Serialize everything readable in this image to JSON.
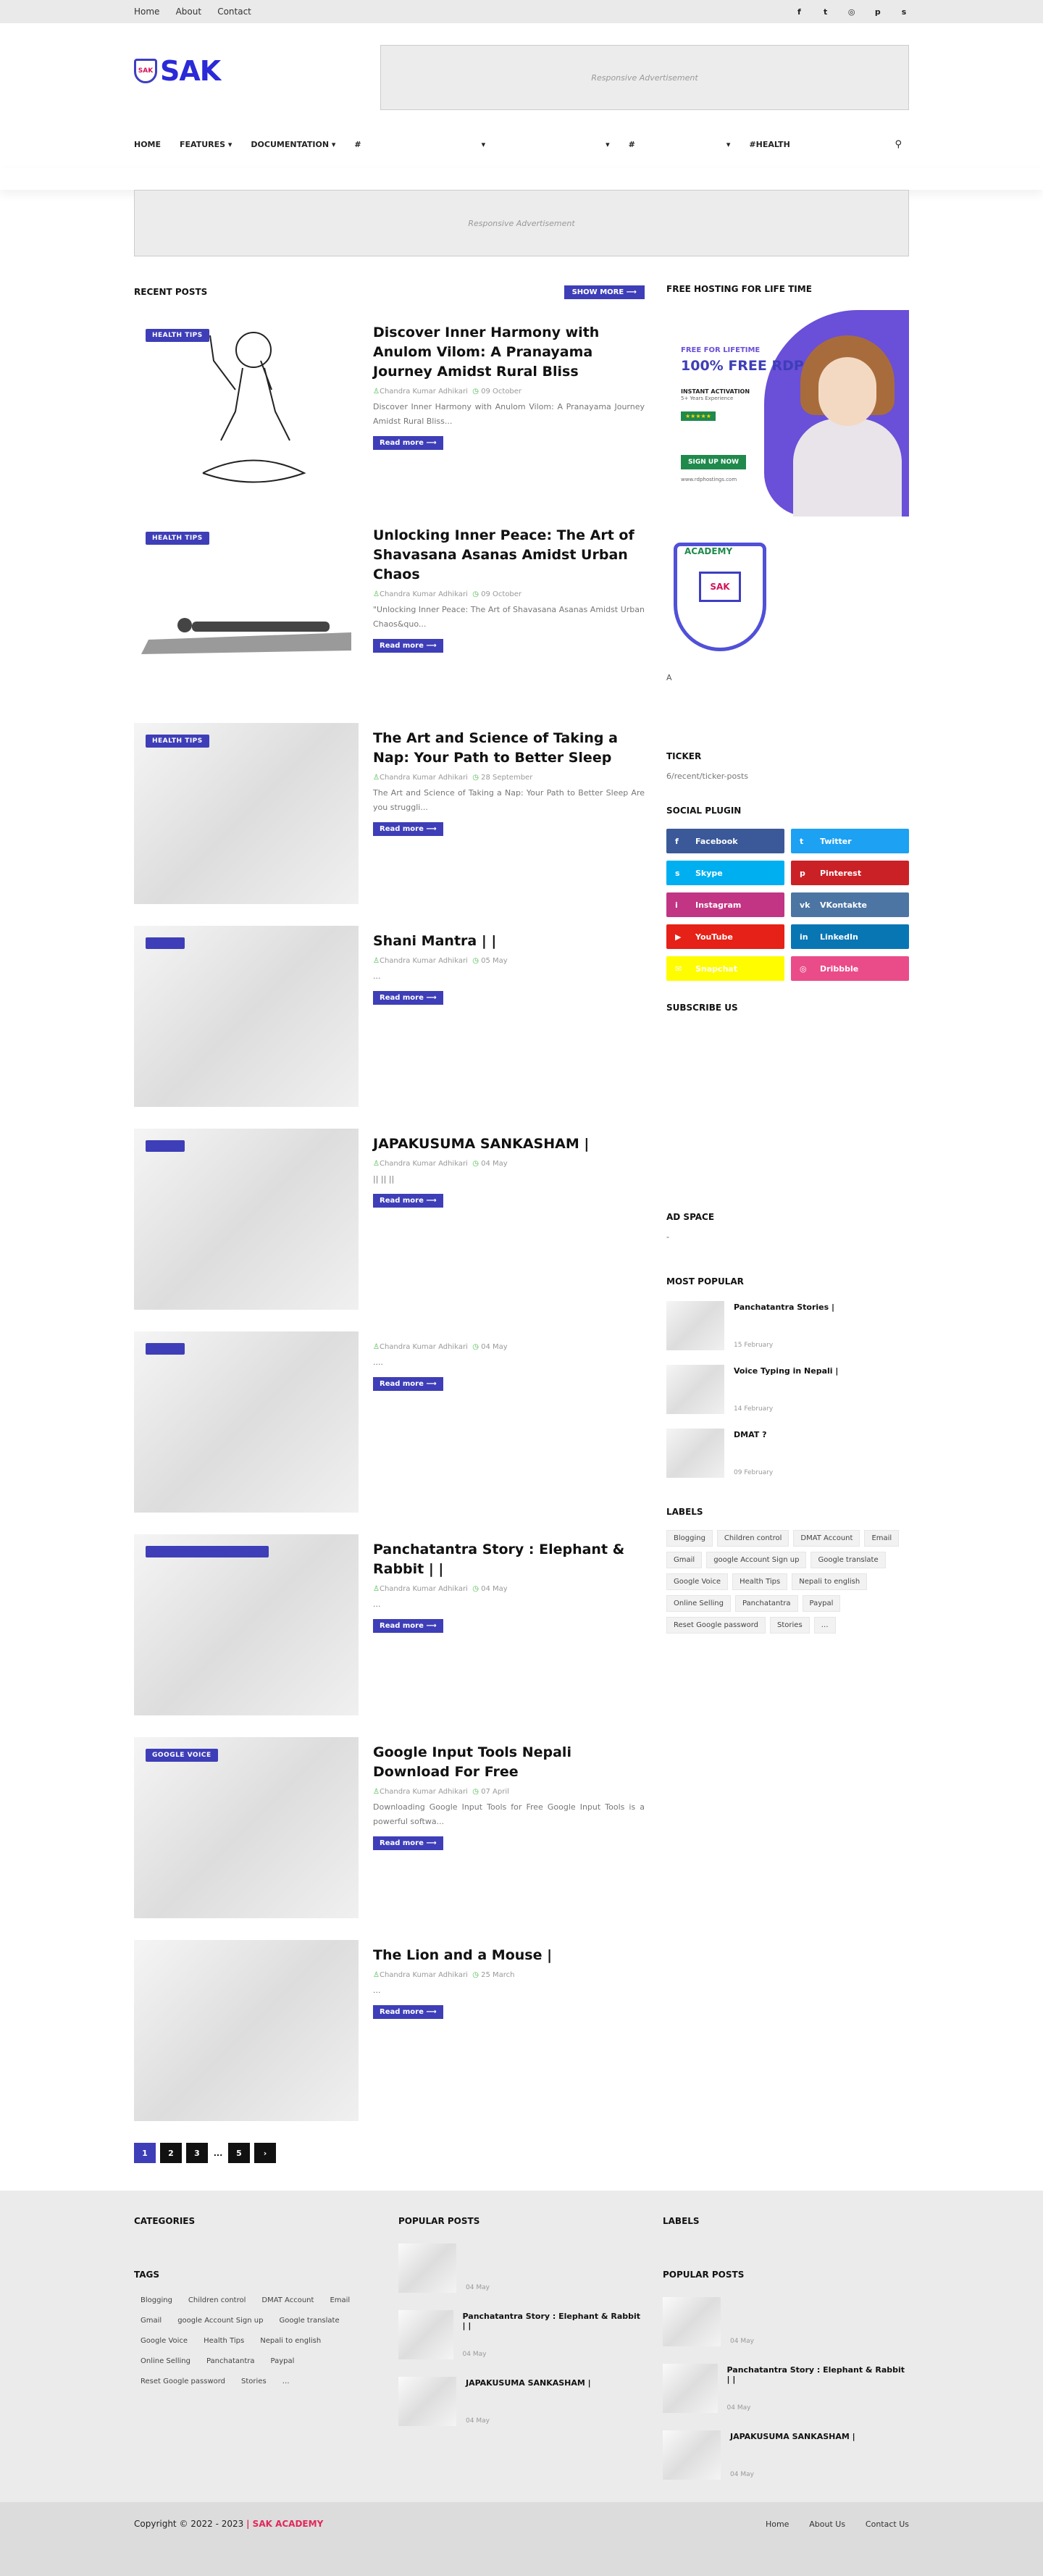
{
  "topbar": {
    "menu": [
      "Home",
      "About",
      "Contact"
    ],
    "social_icons": [
      "facebook-icon",
      "twitter-icon",
      "instagram-icon",
      "pinterest-icon",
      "skype-icon"
    ]
  },
  "header": {
    "logo_text": "SAK",
    "logo_badge": "SAK",
    "ad_text": "Responsive Advertisement"
  },
  "nav": {
    "items": [
      "HOME",
      "FEATURES ▾",
      "DOCUMENTATION ▾",
      "#",
      "▾",
      "▾",
      "#",
      "▾",
      "#HEALTH"
    ]
  },
  "ad2_text": "Responsive Advertisement",
  "main": {
    "heading": "RECENT POSTS",
    "show_more": "SHOW MORE ⟶",
    "read_more": "Read more ⟶",
    "posts": [
      {
        "badge": "HEALTH TIPS",
        "title": "Discover Inner Harmony with Anulom Vilom: A Pranayama Journey Amidst Rural Bliss",
        "author": "Chandra Kumar Adhikari",
        "date": "09 October",
        "snippet": "Discover Inner Harmony with Anulom Vilom: A Pranayama Journey Amidst Rural Bliss..."
      },
      {
        "badge": "HEALTH TIPS",
        "title": "Unlocking Inner Peace: The Art of Shavasana Asanas Amidst Urban Chaos",
        "author": "Chandra Kumar Adhikari",
        "date": "09 October",
        "snippet": "\"Unlocking Inner Peace: The Art of Shavasana Asanas Amidst Urban Chaos&quo..."
      },
      {
        "badge": "HEALTH TIPS",
        "title": "The Art and Science of Taking a Nap: Your Path to Better Sleep",
        "author": "Chandra Kumar Adhikari",
        "date": "28 September",
        "snippet": "The Art and Science of Taking a Nap: Your Path to Better Sleep Are you struggli..."
      },
      {
        "badge": "",
        "title": "Shani Mantra |                               |",
        "author": "Chandra Kumar Adhikari",
        "date": "05 May",
        "snippet": "..."
      },
      {
        "badge": "",
        "title": "JAPAKUSUMA SANKASHAM |",
        "author": "Chandra Kumar Adhikari",
        "date": "04 May",
        "snippet": "||    ||                                               ||"
      },
      {
        "badge": "",
        "title": "",
        "author": "Chandra Kumar Adhikari",
        "date": "04 May",
        "snippet": "...."
      },
      {
        "badge": "",
        "title": "Panchatantra Story : Elephant & Rabbit |                              |",
        "author": "Chandra Kumar Adhikari",
        "date": "04 May",
        "snippet": "..."
      },
      {
        "badge": "GOOGLE VOICE",
        "title": "Google Input Tools Nepali Download For Free",
        "author": "Chandra Kumar Adhikari",
        "date": "07 April",
        "snippet": "Downloading Google Input Tools for Free Google Input Tools is a powerful softwa..."
      },
      {
        "badge": "",
        "title": "The Lion and a Mouse |",
        "author": "Chandra Kumar Adhikari",
        "date": "25 March",
        "snippet": "..."
      }
    ],
    "pager": [
      "1",
      "2",
      "3",
      "...",
      "5",
      "›"
    ]
  },
  "sidebar": {
    "hosting_title": "FREE HOSTING FOR LIFE TIME",
    "banner": {
      "t1": "FREE FOR LIFETIME",
      "t2": "100% FREE RDP",
      "t3": "INSTANT ACTIVATION",
      "t4": "5+ Years Experience",
      "stars": "★★★★★",
      "signup": "SIGN UP NOW",
      "url": "www.rdphostings.com"
    },
    "academy": {
      "tag": "ACADEMY",
      "mon": "SAK"
    },
    "letter": "A",
    "ticker_title": "TICKER",
    "ticker_text": "6/recent/ticker-posts",
    "social_title": "SOCIAL PLUGIN",
    "social": [
      {
        "label": "Facebook",
        "icon": "f",
        "color": "#3b5998"
      },
      {
        "label": "Twitter",
        "icon": "t",
        "color": "#1da1f2"
      },
      {
        "label": "Skype",
        "icon": "s",
        "color": "#00aff0"
      },
      {
        "label": "Pinterest",
        "icon": "p",
        "color": "#ca2127"
      },
      {
        "label": "Instagram",
        "icon": "i",
        "color": "#c13584"
      },
      {
        "label": "VKontakte",
        "icon": "vk",
        "color": "#4c75a3"
      },
      {
        "label": "YouTube",
        "icon": "▶",
        "color": "#e62117"
      },
      {
        "label": "LinkedIn",
        "icon": "in",
        "color": "#0976b4"
      },
      {
        "label": "Snapchat",
        "icon": "✉",
        "color": "#fffc00"
      },
      {
        "label": "Dribbble",
        "icon": "◎",
        "color": "#ea4c89"
      }
    ],
    "subscribe_title": "SUBSCRIBE US",
    "adspace_title": "AD SPACE",
    "adspace_text": "-",
    "popular_title": "MOST POPULAR",
    "popular": [
      {
        "title": "Panchatantra Stories |",
        "date": "15 February"
      },
      {
        "title": "Voice Typing in Nepali |",
        "date": "14 February"
      },
      {
        "title": "DMAT                               ?",
        "date": "09 February"
      }
    ],
    "labels_title": "LABELS",
    "labels": [
      "Blogging",
      "Children control",
      "DMAT Account",
      "Email",
      "Gmail",
      "google Account Sign up",
      "Google translate",
      "Google Voice",
      "Health Tips",
      "Nepali to english",
      "Online Selling",
      "Panchatantra",
      "Paypal",
      "Reset Google password",
      "Stories",
      "…"
    ]
  },
  "footer": {
    "categories_title": "CATEGORIES",
    "tags_title": "TAGS",
    "tags": [
      "Blogging",
      "Children control",
      "DMAT Account",
      "Email",
      "Gmail",
      "google Account Sign up",
      "Google translate",
      "Google Voice",
      "Health Tips",
      "Nepali to english",
      "Online Selling",
      "Panchatantra",
      "Paypal",
      "Reset Google password",
      "Stories",
      "…"
    ],
    "popular_title": "POPULAR POSTS",
    "popular": [
      {
        "title": "",
        "date": "04 May"
      },
      {
        "title": "Panchatantra Story : Elephant & Rabbit |                          |",
        "date": "04 May"
      },
      {
        "title": "JAPAKUSUMA SANKASHAM |",
        "date": "04 May"
      }
    ],
    "labels_title": "LABELS",
    "popular2_title": "POPULAR POSTS",
    "popular2": [
      {
        "title": "",
        "date": "04 May"
      },
      {
        "title": "Panchatantra Story : Elephant & Rabbit |                          |",
        "date": "04 May"
      },
      {
        "title": "JAPAKUSUMA SANKASHAM |",
        "date": "04 May"
      }
    ],
    "copyright": "Copyright © 2022 - 2023 ",
    "brand": "| SAK ACADEMY",
    "links": [
      "Home",
      "About Us",
      "Contact Us"
    ]
  }
}
